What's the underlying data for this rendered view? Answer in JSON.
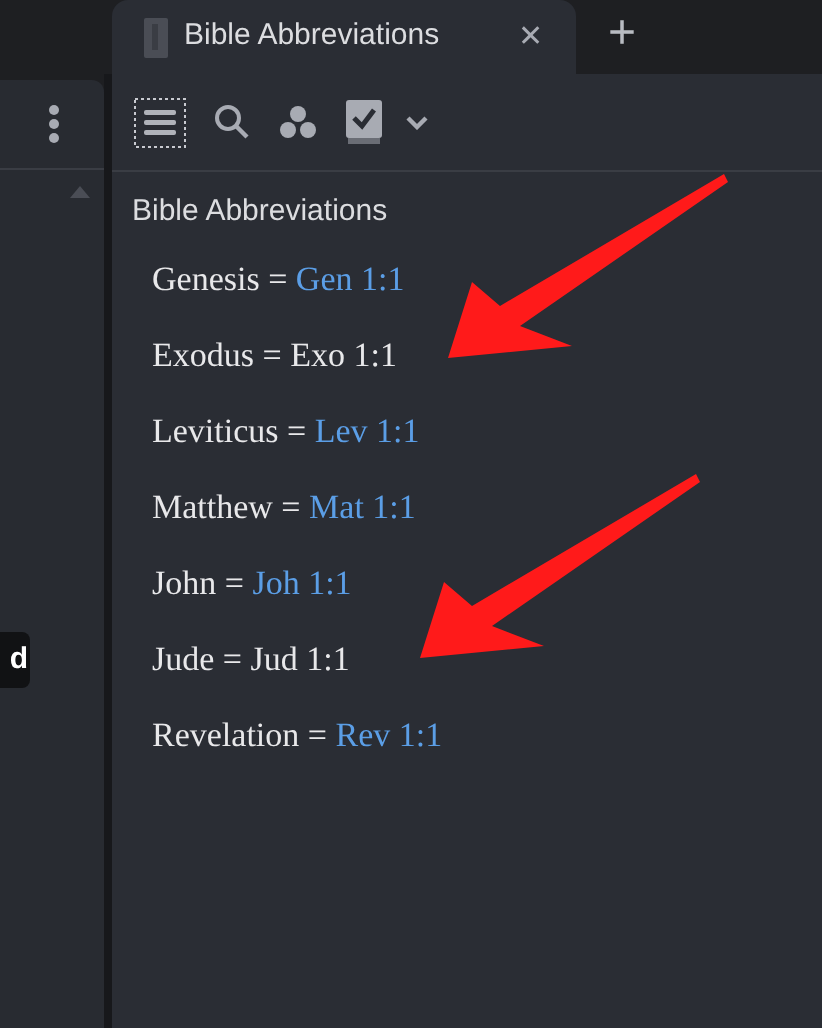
{
  "tab": {
    "title": "Bible Abbreviations",
    "close": "✕",
    "new_tab": "+"
  },
  "left_pane": {
    "badge": "d"
  },
  "heading": "Bible Abbreviations",
  "entries": [
    {
      "text": "Genesis =",
      "ref": "Gen 1:1",
      "linked": true
    },
    {
      "text": "Exodus =",
      "ref": "Exo 1:1",
      "linked": false
    },
    {
      "text": "Leviticus =",
      "ref": "Lev 1:1",
      "linked": true
    },
    {
      "text": "Matthew =",
      "ref": "Mat 1:1",
      "linked": true
    },
    {
      "text": "John =",
      "ref": "Joh 1:1",
      "linked": true
    },
    {
      "text": "Jude =",
      "ref": "Jud 1:1",
      "linked": false
    },
    {
      "text": "Revelation =",
      "ref": "Rev 1:1",
      "linked": true
    }
  ],
  "annotations": [
    {
      "kind": "arrow"
    },
    {
      "kind": "arrow"
    }
  ]
}
